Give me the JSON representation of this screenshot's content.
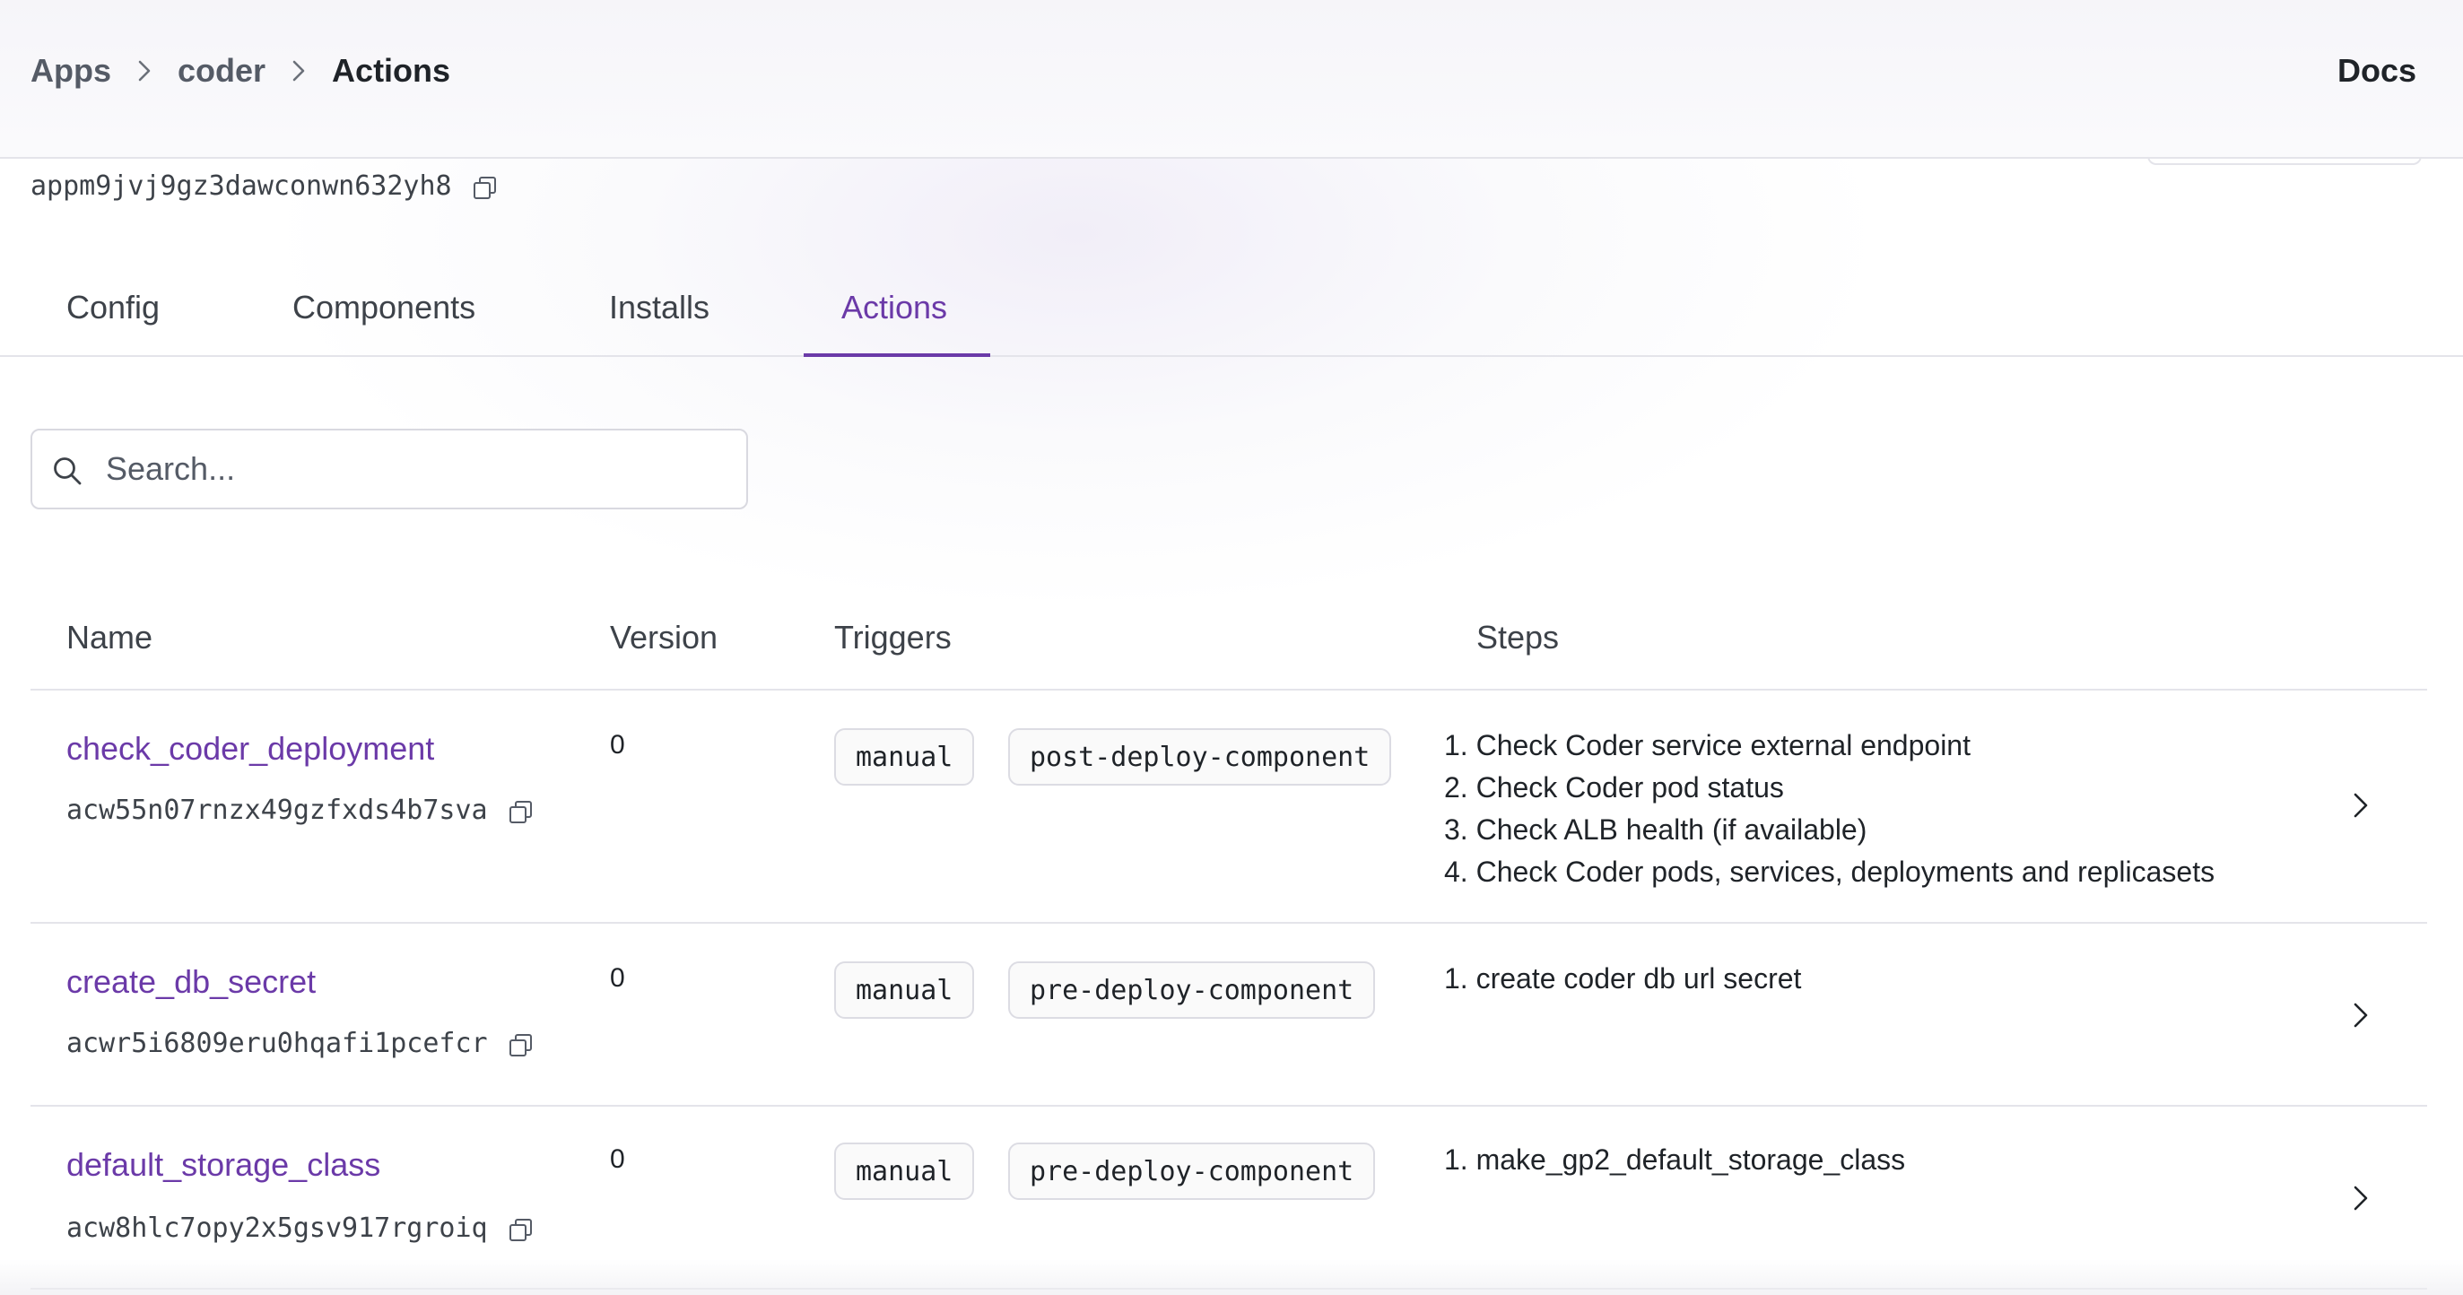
{
  "breadcrumb": {
    "items": [
      "Apps",
      "coder",
      "Actions"
    ]
  },
  "header": {
    "docs_label": "Docs"
  },
  "app": {
    "id": "appm9jvj9gz3dawconwn632yh8"
  },
  "tabs": [
    {
      "label": "Config"
    },
    {
      "label": "Components"
    },
    {
      "label": "Installs"
    },
    {
      "label": "Actions",
      "active": true
    }
  ],
  "search": {
    "placeholder": "Search...",
    "value": ""
  },
  "table": {
    "columns": [
      "Name",
      "Version",
      "Triggers",
      "Steps"
    ],
    "rows": [
      {
        "name": "check_coder_deployment",
        "id": "acw55n07rnzx49gzfxds4b7sva",
        "version": "0",
        "triggers": [
          "manual",
          "post-deploy-component"
        ],
        "steps": [
          "1. Check Coder service external endpoint",
          "2. Check Coder pod status",
          "3. Check ALB health (if available)",
          "4. Check Coder pods, services, deployments and replicasets"
        ]
      },
      {
        "name": "create_db_secret",
        "id": "acwr5i6809eru0hqafi1pcefcr",
        "version": "0",
        "triggers": [
          "manual",
          "pre-deploy-component"
        ],
        "steps": [
          "1. create coder db url secret"
        ]
      },
      {
        "name": "default_storage_class",
        "id": "acw8hlc7opy2x5gsv917rgroiq",
        "version": "0",
        "triggers": [
          "manual",
          "pre-deploy-component"
        ],
        "steps": [
          "1. make_gp2_default_storage_class"
        ]
      }
    ]
  },
  "colors": {
    "accent": "#6b3aa8",
    "border": "#e4e4ea",
    "text": "#1f2328",
    "muted": "#3d4249"
  },
  "icons": {
    "breadcrumb_separator": "chevron-right-icon",
    "copy": "copy-icon",
    "search": "search-icon",
    "row_open": "chevron-right-icon"
  }
}
